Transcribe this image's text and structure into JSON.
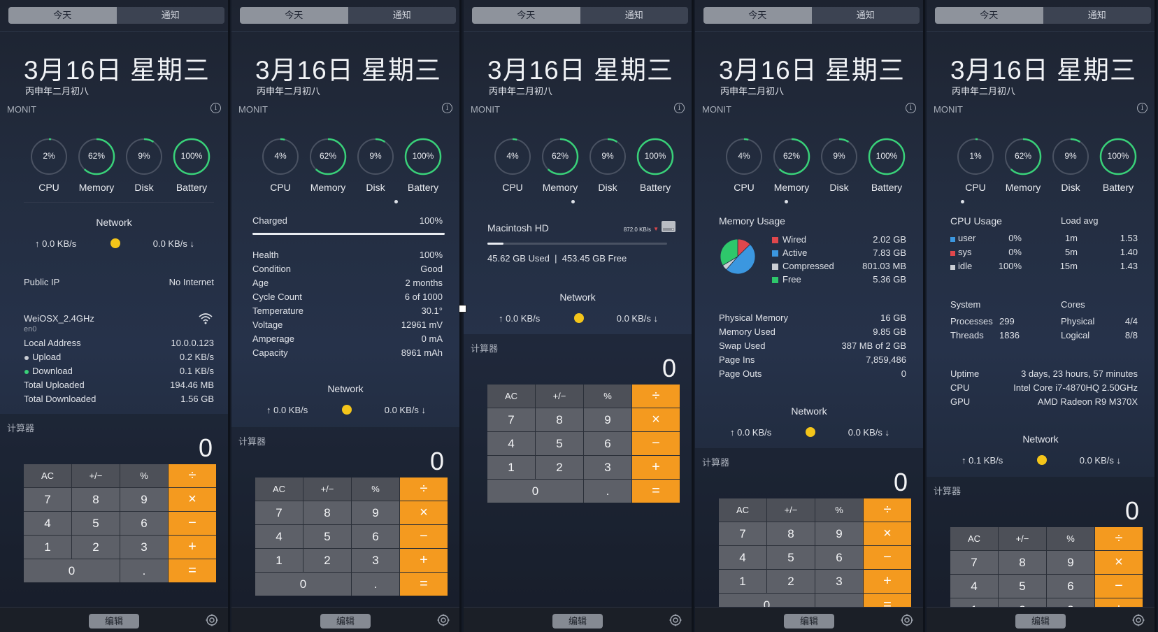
{
  "common": {
    "tab_today": "今天",
    "tab_notifications": "通知",
    "date": "3月16日 星期三",
    "lunar": "丙申年二月初八",
    "monit_title": "MONIT",
    "info_glyph": "i",
    "ring_labels": [
      "CPU",
      "Memory",
      "Disk",
      "Battery"
    ],
    "calc_title": "计算器",
    "calc_display": "0",
    "edit_label": "编辑",
    "keys": {
      "ac": "AC",
      "sign": "+/−",
      "pct": "%",
      "div": "÷",
      "mul": "×",
      "sub": "−",
      "add": "+",
      "eq": "=",
      "dot": ".",
      "n0": "0",
      "n1": "1",
      "n2": "2",
      "n3": "3",
      "n4": "4",
      "n5": "5",
      "n6": "6",
      "n7": "7",
      "n8": "8",
      "n9": "9"
    },
    "network_title": "Network"
  },
  "panels": [
    {
      "rings": [
        "2%",
        "62%",
        "9%",
        "100%"
      ],
      "ring_fraction": [
        0.02,
        0.62,
        0.09,
        1.0
      ],
      "network": {
        "up": "↑ 0.0 KB/s",
        "down": "0.0 KB/s ↓"
      },
      "public_ip": {
        "label": "Public IP",
        "value": "No Internet"
      },
      "wifi": {
        "ssid": "WeiOSX_2.4GHz",
        "iface": "en0"
      },
      "rows": [
        [
          "Local Address",
          "10.0.0.123"
        ],
        [
          "Upload",
          "0.2 KB/s"
        ],
        [
          "Download",
          "0.1 KB/s"
        ],
        [
          "Total Uploaded",
          "194.46 MB"
        ],
        [
          "Total Downloaded",
          "1.56 GB"
        ]
      ]
    },
    {
      "rings": [
        "4%",
        "62%",
        "9%",
        "100%"
      ],
      "ring_fraction": [
        0.04,
        0.62,
        0.09,
        1.0
      ],
      "charged": {
        "label": "Charged",
        "value": "100%",
        "fraction": 1.0
      },
      "rows": [
        [
          "Health",
          "100%"
        ],
        [
          "Condition",
          "Good"
        ],
        [
          "Age",
          "2 months"
        ],
        [
          "Cycle Count",
          "6 of 1000"
        ],
        [
          "Temperature",
          "30.1°"
        ],
        [
          "Voltage",
          "12961 mV"
        ],
        [
          "Amperage",
          "0 mA"
        ],
        [
          "Capacity",
          "8961 mAh"
        ]
      ],
      "network": {
        "up": "↑ 0.0 KB/s",
        "down": "0.0 KB/s ↓"
      }
    },
    {
      "rings": [
        "4%",
        "62%",
        "9%",
        "100%"
      ],
      "ring_fraction": [
        0.04,
        0.62,
        0.09,
        1.0
      ],
      "disk": {
        "name": "Macintosh HD",
        "speed": "872.0 KB/s",
        "used": "45.62 GB Used",
        "free": "453.45 GB Free",
        "fraction": 0.09
      },
      "network": {
        "up": "↑ 0.0 KB/s",
        "down": "0.0 KB/s ↓"
      }
    },
    {
      "rings": [
        "4%",
        "62%",
        "9%",
        "100%"
      ],
      "ring_fraction": [
        0.04,
        0.62,
        0.09,
        1.0
      ],
      "mem_title": "Memory Usage",
      "legend": [
        {
          "name": "Wired",
          "value": "2.02 GB",
          "color": "#e0474c"
        },
        {
          "name": "Active",
          "value": "7.83 GB",
          "color": "#3b97e0"
        },
        {
          "name": "Compressed",
          "value": "801.03 MB",
          "color": "#c9cdd4"
        },
        {
          "name": "Free",
          "value": "5.36 GB",
          "color": "#2ec76b"
        }
      ],
      "rows": [
        [
          "Physical Memory",
          "16 GB"
        ],
        [
          "Memory Used",
          "9.85 GB"
        ],
        [
          "Swap Used",
          "387 MB of 2 GB"
        ],
        [
          "Page Ins",
          "7,859,486"
        ],
        [
          "Page Outs",
          "0"
        ]
      ],
      "network": {
        "up": "↑ 0.0 KB/s",
        "down": "0.0 KB/s ↓"
      }
    },
    {
      "rings": [
        "1%",
        "62%",
        "9%",
        "100%"
      ],
      "ring_fraction": [
        0.01,
        0.62,
        0.09,
        1.0
      ],
      "cpu_title": "CPU Usage",
      "load_title": "Load avg",
      "cpu": [
        {
          "name": "user",
          "value": "0%",
          "color": "#3b97e0"
        },
        {
          "name": "sys",
          "value": "0%",
          "color": "#e0474c"
        },
        {
          "name": "idle",
          "value": "100%",
          "color": "#c9cdd4"
        }
      ],
      "load": [
        [
          "1m",
          "1.53"
        ],
        [
          "5m",
          "1.40"
        ],
        [
          "15m",
          "1.43"
        ]
      ],
      "system_title": "System",
      "cores_title": "Cores",
      "system": [
        [
          "Processes",
          "299"
        ],
        [
          "Threads",
          "1836"
        ]
      ],
      "cores": [
        [
          "Physical",
          "4/4"
        ],
        [
          "Logical",
          "8/8"
        ]
      ],
      "rows": [
        [
          "Uptime",
          "3 days, 23 hours, 57 minutes"
        ],
        [
          "CPU",
          "Intel Core i7-4870HQ 2.50GHz"
        ],
        [
          "GPU",
          "AMD Radeon R9 M370X"
        ]
      ],
      "network": {
        "up": "↑ 0.1 KB/s",
        "down": "0.0 KB/s ↓"
      }
    }
  ]
}
